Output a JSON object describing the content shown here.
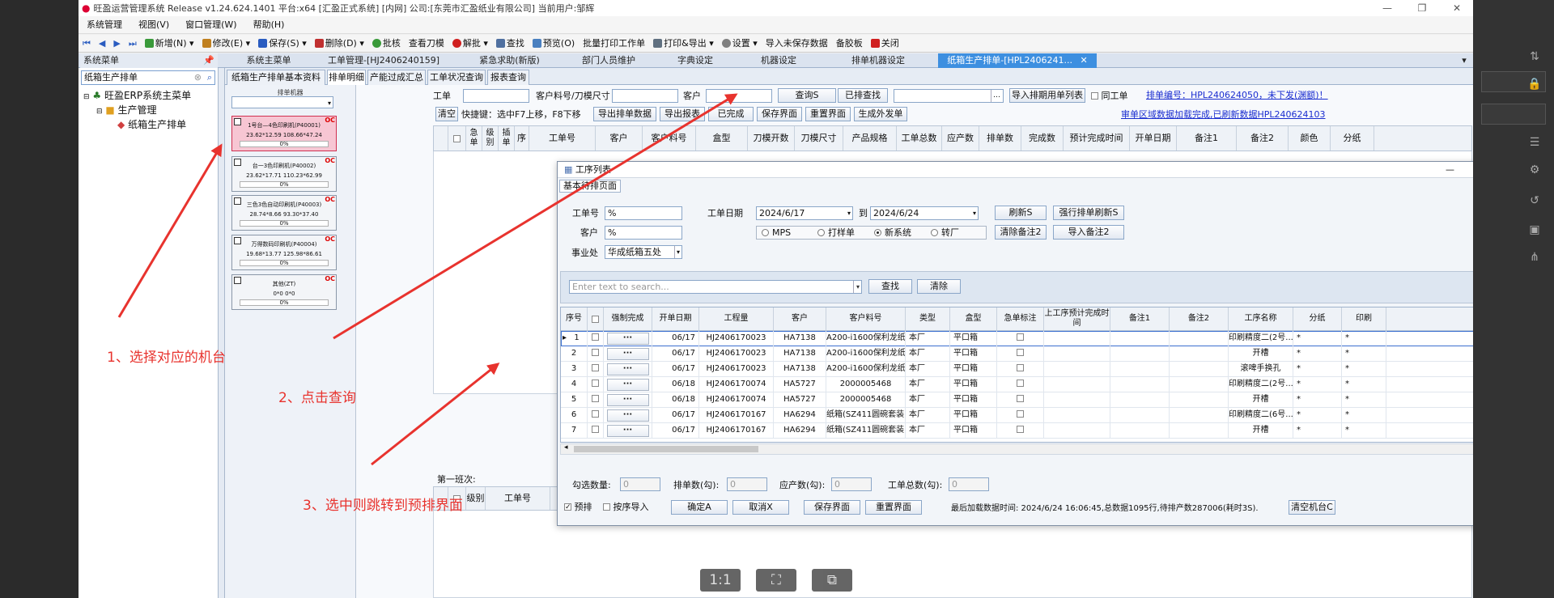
{
  "window": {
    "title": "旺盈运营管理系统 Release v1.24.624.1401 平台:x64 [汇盈正式系统] [内网] 公司:[东莞市汇盈纸业有限公司] 当前用户:邹辉"
  },
  "menu": [
    "系统管理",
    "视图(V)",
    "窗口管理(W)",
    "帮助(H)"
  ],
  "toolbar": [
    "新增(N)",
    "修改(E)",
    "保存(S)",
    "删除(D)",
    "批核",
    "查看刀模",
    "解批",
    "查找",
    "预览(O)",
    "批量打印工作单",
    "打印&导出",
    "设置",
    "导入未保存数据",
    "备胶板",
    "关闭"
  ],
  "doctabs": {
    "sys_menu": "系统菜单",
    "items": [
      "系统主菜单",
      "工单管理-[HJ2406240159]",
      "紧急求助(新版)",
      "部门人员维护",
      "字典设定",
      "机器设定",
      "排单机器设定",
      "纸箱生产排单-[HPL2406241..."
    ]
  },
  "sidebar": {
    "search_value": "纸箱生产排单",
    "tree": [
      "旺盈ERP系统主菜单",
      "生产管理",
      "纸箱生产排单"
    ]
  },
  "subtabs": [
    "纸箱生产排单基本资料",
    "排单明细",
    "产能过成汇总",
    "工单状况查询",
    "报表查询"
  ],
  "machines": {
    "header": "排单机器",
    "items": [
      {
        "name": "1号台—4色印刷机(P40001)",
        "dims": "23.62*12.59  108.66*47.24",
        "pct": "0%",
        "oc": "OC"
      },
      {
        "name": "台一3色印刷机(P40002)",
        "dims": "23.62*17.71  110.23*62.99",
        "pct": "0%",
        "oc": "OC"
      },
      {
        "name": "三色3色自动印刷机(P40003)",
        "dims": "28.74*8.66  93.30*37.40",
        "pct": "0%",
        "oc": "OC"
      },
      {
        "name": "万得数码印刷机(P40004)",
        "dims": "19.68*13.77  125.98*86.61",
        "pct": "0%",
        "oc": "OC"
      },
      {
        "name": "其他(ZT)",
        "dims": "0*0  0*0",
        "pct": "0%",
        "oc": "OC"
      }
    ]
  },
  "filters": {
    "work_order": "工单",
    "cust_item": "客户料号/刀模尺寸",
    "customer": "客户",
    "query_btn": "查询S",
    "scheduled_btn": "已排查找",
    "import_btn": "导入排期用单列表",
    "same_order": "同工单",
    "status_link": "排单编号：HPL240624050，未下发(渊额)！",
    "clear": "清空",
    "shortcut_label": "快捷键：",
    "shortcut_text": "选中F7上移，F8下移",
    "btn_export": "导出排单数据",
    "btn_report": "导出报表",
    "btn_done": "已完成",
    "btn_save": "保存界面",
    "btn_reset": "重置界面",
    "btn_outsource": "生成外发单",
    "info_link": "审单区域数据加载完成,已刷新数据HPL240624103"
  },
  "main_columns": [
    "急单",
    "级别",
    "插单",
    "序",
    "工单号",
    "客户",
    "客户料号",
    "盒型",
    "刀模开数",
    "刀模尺寸",
    "产品规格",
    "工单总数",
    "应产数",
    "排单数",
    "完成数",
    "预计完成时间",
    "开单日期",
    "备注1",
    "备注2",
    "颜色",
    "分纸"
  ],
  "first_shift": "第一班次:",
  "bottom_columns": [
    "级别",
    "工单号"
  ],
  "dialog": {
    "title": "工序列表",
    "tab": "基本待排页面",
    "labels": {
      "work_order": "工单号",
      "customer": "客户",
      "division": "事业处",
      "date": "工单日期",
      "to": "到"
    },
    "work_order_value": "%",
    "customer_value": "%",
    "division_value": "华成纸箱五处",
    "date_from": "2024/6/17",
    "date_to": "2024/6/24",
    "btn_refresh": "刷新S",
    "btn_force_refresh": "强行排单刷新S",
    "btn_clear_note": "清除备注2",
    "btn_import_note": "导入备注2",
    "radios": [
      "MPS",
      "打样单",
      "新系统",
      "转厂"
    ],
    "radio_selected": "新系统",
    "search_placeholder": "Enter text to search...",
    "btn_find": "查找",
    "btn_clear": "清除",
    "columns": [
      "序号",
      "强制完成",
      "开单日期",
      "工程量",
      "客户",
      "客户料号",
      "类型",
      "盒型",
      "急单标注",
      "上工序预计完成时间",
      "备注1",
      "备注2",
      "工序名称",
      "分纸",
      "印刷"
    ],
    "rows": [
      [
        "1",
        "06/17",
        "HJ2406170023",
        "HA7138",
        "A200-i1600保利龙纸...",
        "本厂",
        "平口箱",
        "印刷精度二(2号...",
        "*",
        "*"
      ],
      [
        "2",
        "06/17",
        "HJ2406170023",
        "HA7138",
        "A200-i1600保利龙纸...",
        "本厂",
        "平口箱",
        "开槽",
        "*",
        "*"
      ],
      [
        "3",
        "06/17",
        "HJ2406170023",
        "HA7138",
        "A200-i1600保利龙纸...",
        "本厂",
        "平口箱",
        "滚啤手换孔",
        "*",
        "*"
      ],
      [
        "4",
        "06/18",
        "HJ2406170074",
        "HA5727",
        "2000005468",
        "本厂",
        "平口箱",
        "印刷精度二(2号...",
        "*",
        "*"
      ],
      [
        "5",
        "06/18",
        "HJ2406170074",
        "HA5727",
        "2000005468",
        "本厂",
        "平口箱",
        "开槽",
        "*",
        "*"
      ],
      [
        "6",
        "06/17",
        "HJ2406170167",
        "HA6294",
        "纸箱(SZ411圆碗套装)...",
        "本厂",
        "平口箱",
        "印刷精度二(6号...",
        "*",
        "*"
      ],
      [
        "7",
        "06/17",
        "HJ2406170167",
        "HA6294",
        "纸箱(SZ411圆碗套装)...",
        "本厂",
        "平口箱",
        "开槽",
        "*",
        "*"
      ]
    ],
    "footer": {
      "checked": "勾选数量:",
      "checked_val": "0",
      "sched": "排单数(勾):",
      "sched_val": "0",
      "should": "应产数(勾):",
      "should_val": "0",
      "total": "工单总数(勾):",
      "total_val": "0",
      "presort": "预排",
      "order_import": "按序导入",
      "btn_confirm": "确定A",
      "btn_cancel": "取消X",
      "btn_save": "保存界面",
      "btn_reset": "重置界面",
      "last_load": "最后加载数据时间: 2024/6/24 16:06:45,总数据1095行,待排产数287006(耗时3S).",
      "btn_clear_machine": "清空机台C"
    }
  },
  "annotations": [
    "1、选择对应的机台",
    "2、点击查询",
    "3、选中则跳转到预排界面"
  ],
  "viewer": [
    "1:1",
    "⛶",
    "⧉"
  ],
  "colors": {
    "annotation": "#e8332e",
    "active_tab": "#3d8fe0",
    "link": "#1a2dd0",
    "selected_machine": "#f7c6d3"
  }
}
